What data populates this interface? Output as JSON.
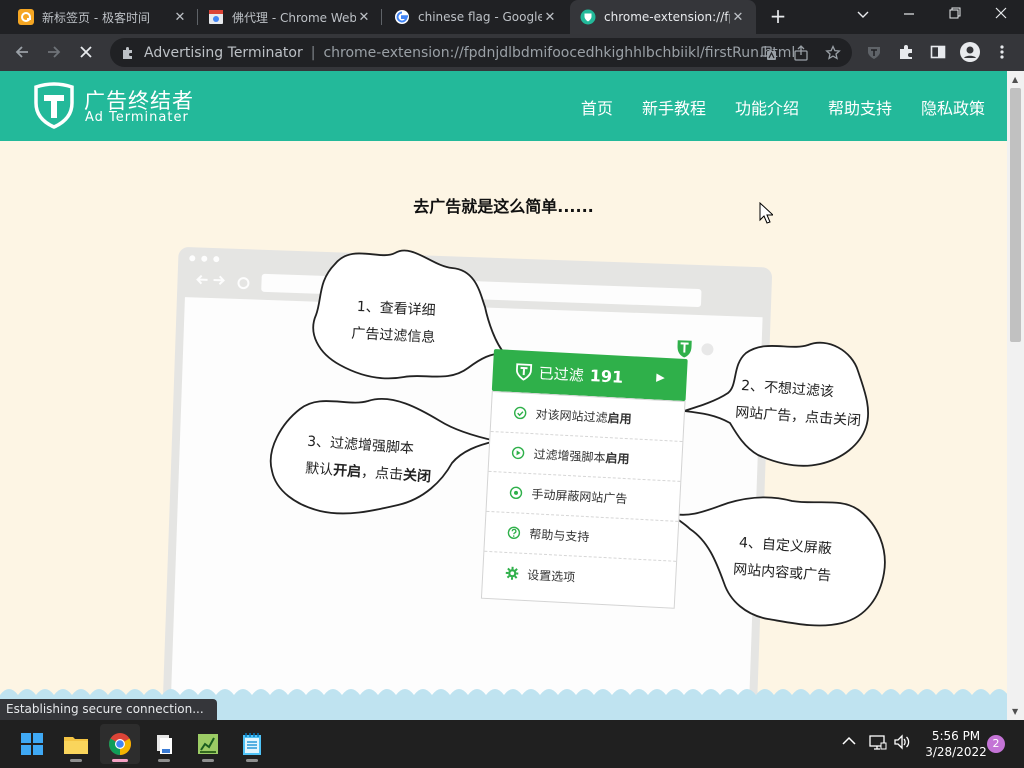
{
  "tabs": [
    {
      "title": "新标签页 - 极客时间",
      "favicon": "geek-time-icon"
    },
    {
      "title": "佛代理 - Chrome Web",
      "favicon": "chrome-web-store-icon"
    },
    {
      "title": "chinese flag - Google S",
      "favicon": "google-icon"
    },
    {
      "title": "chrome-extension://fp",
      "favicon": "ad-terminator-icon",
      "active": true
    }
  ],
  "omnibox": {
    "site_name": "Advertising Terminator",
    "url": "chrome-extension://fpdnjdlbdmifoocedhkighhlbchbiikl/firstRun.html"
  },
  "header": {
    "logo_cn": "广告终结者",
    "logo_en": "Ad Terminater",
    "nav": [
      "首页",
      "新手教程",
      "功能介绍",
      "帮助支持",
      "隐私政策"
    ]
  },
  "headline": "去广告就是这么简单......",
  "popup": {
    "filtered_label": "已过滤",
    "filtered_count": "191",
    "rows": [
      {
        "text": "对该网站过滤",
        "bold": "启用",
        "icon": "check-circle-icon"
      },
      {
        "text": "过滤增强脚本",
        "bold": "启用",
        "icon": "play-circle-icon"
      },
      {
        "text": "手动屏蔽网站广告",
        "bold": "",
        "icon": "eye-icon"
      },
      {
        "text": "帮助与支持",
        "bold": "",
        "icon": "question-circle-icon"
      },
      {
        "text": "设置选项",
        "bold": "",
        "icon": "gear-icon"
      }
    ]
  },
  "bubbles": {
    "b1_line1": "1、查看详细",
    "b1_line2": "广告过滤信息",
    "b2_line1": "2、不想过滤该",
    "b2_line2": "网站广告，点击关闭",
    "b3_line1": "3、过滤增强脚本",
    "b3_line2_pre": "默认",
    "b3_line2_bold1": "开启",
    "b3_line2_mid": "，点击",
    "b3_line2_bold2": "关闭",
    "b4_line1": "4、自定义屏蔽",
    "b4_line2": "网站内容或广告"
  },
  "status_text": "Establishing secure connection...",
  "taskbar": {
    "time": "5:56 PM",
    "date": "3/28/2022",
    "notification_count": "2"
  },
  "colors": {
    "header_green": "#23b99a",
    "popup_green": "#2fb04a",
    "page_bg": "#fdf5e4",
    "wave_blue": "#bfe3f0"
  }
}
